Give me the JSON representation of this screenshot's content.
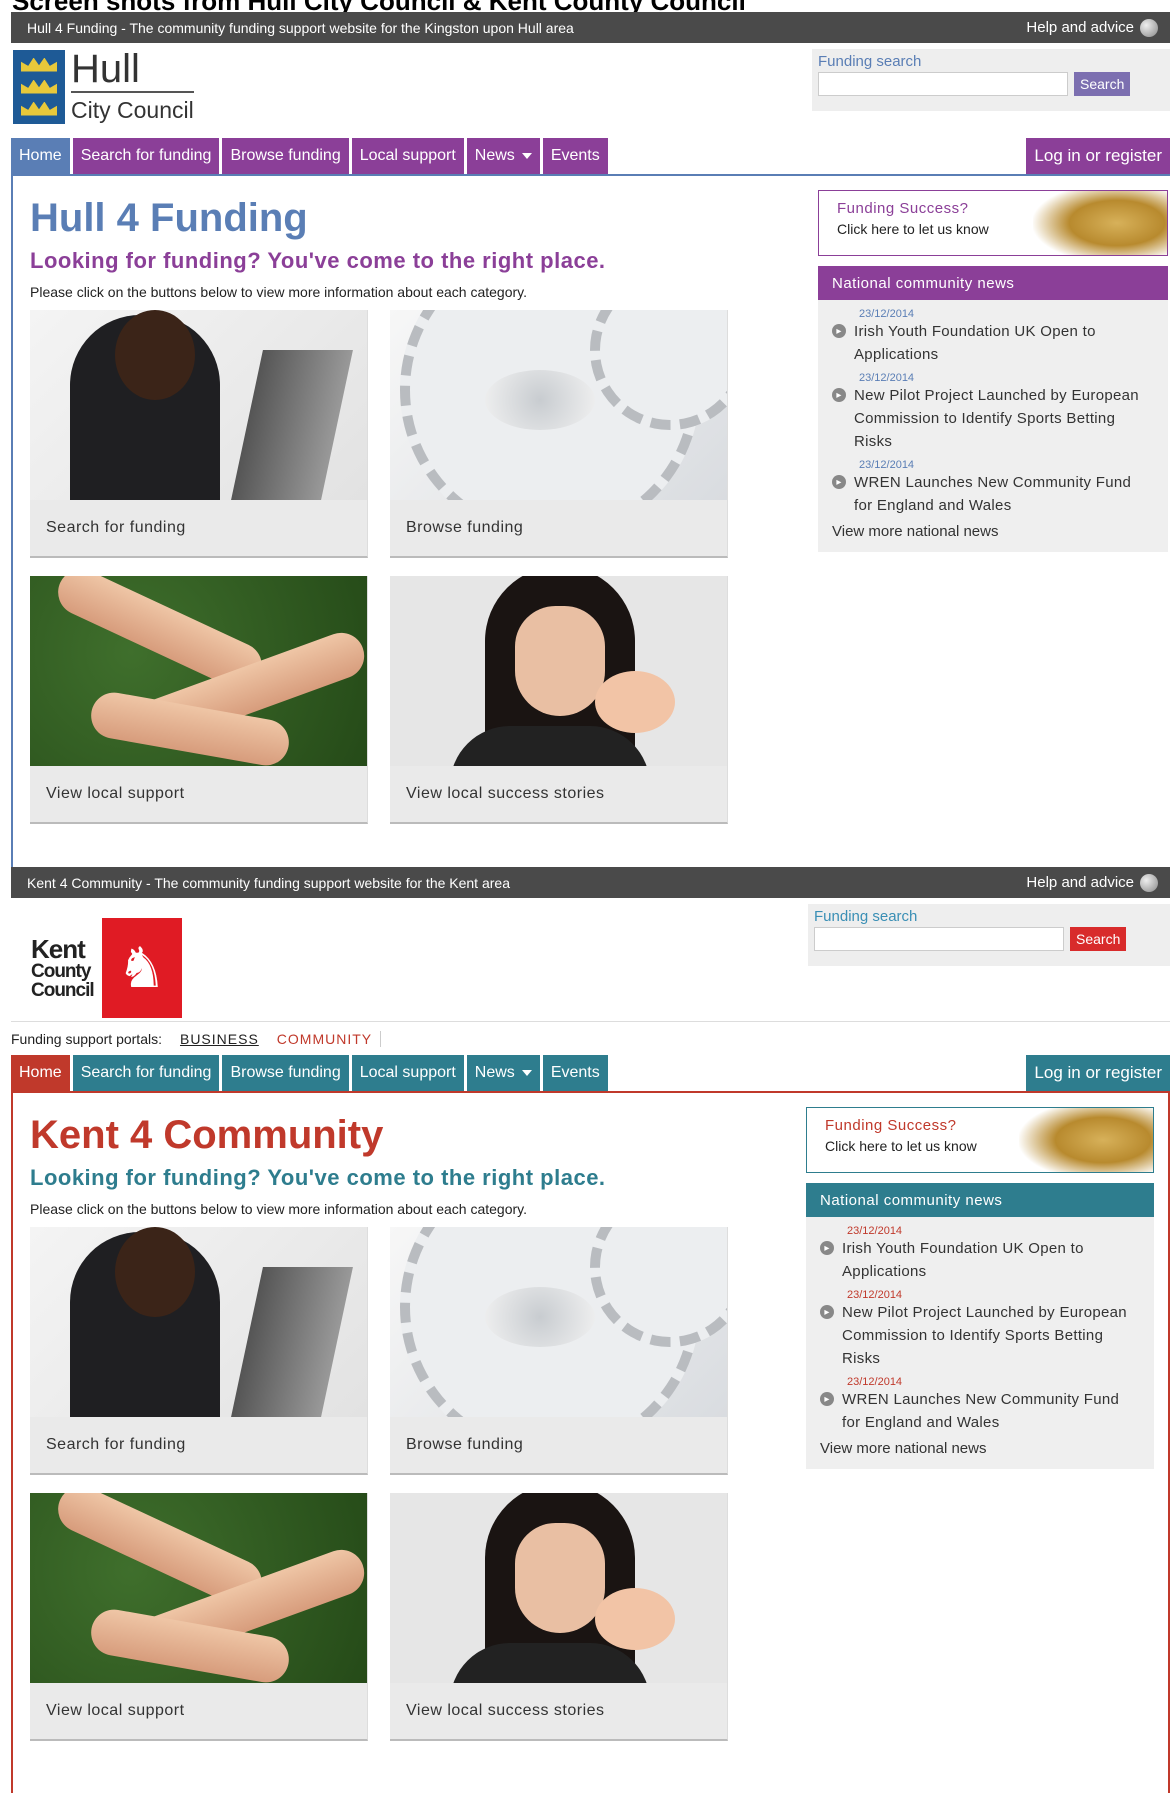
{
  "caption": "Screen shots from Hull City Council & Kent County Council",
  "colors": {
    "hull_primary": "#5a7eb5",
    "hull_accent": "#8b3f98",
    "kent_primary": "#c0392b",
    "kent_accent": "#2e7d8e"
  },
  "hull": {
    "topbar": {
      "title": "Hull 4 Funding - The community funding support website for the Kingston upon Hull area",
      "help": "Help and advice"
    },
    "logo": {
      "line1": "Hull",
      "line2": "City Council"
    },
    "search": {
      "label": "Funding search",
      "button": "Search",
      "value": ""
    },
    "nav": {
      "home": "Home",
      "search": "Search for funding",
      "browse": "Browse funding",
      "local": "Local support",
      "news": "News",
      "events": "Events",
      "login": "Log in or register"
    },
    "main": {
      "title": "Hull 4 Funding",
      "subtitle": "Looking for funding? You've come to the right place.",
      "intro": "Please click on the buttons below to view more information about each category.",
      "tiles": [
        "Search for funding",
        "Browse funding",
        "View local support",
        "View local success stories"
      ]
    },
    "success": {
      "line1": "Funding Success?",
      "line2": "Click here to let us know"
    },
    "news": {
      "heading": "National community news",
      "items": [
        {
          "date": "23/12/2014",
          "title": "Irish Youth Foundation UK Open to Applications"
        },
        {
          "date": "23/12/2014",
          "title": "New Pilot Project Launched by European Commission to Identify Sports Betting Risks"
        },
        {
          "date": "23/12/2014",
          "title": "WREN Launches New Community Fund for England and Wales"
        }
      ],
      "more": "View more national news"
    }
  },
  "kent": {
    "topbar": {
      "title": "Kent 4 Community - The community funding support website for the Kent area",
      "help": "Help and advice"
    },
    "logo": {
      "line1": "Kent",
      "line2": "County",
      "line3": "Council"
    },
    "search": {
      "label": "Funding search",
      "button": "Search",
      "value": ""
    },
    "portals": {
      "label": "Funding support portals:",
      "business": "BUSINESS",
      "community": "COMMUNITY"
    },
    "nav": {
      "home": "Home",
      "search": "Search for funding",
      "browse": "Browse funding",
      "local": "Local support",
      "news": "News",
      "events": "Events",
      "login": "Log in or register"
    },
    "main": {
      "title": "Kent 4 Community",
      "subtitle": "Looking for funding? You've come to the right place.",
      "intro": "Please click on the buttons below to view more information about each category.",
      "tiles": [
        "Search for funding",
        "Browse funding",
        "View local support",
        "View local success stories"
      ]
    },
    "success": {
      "line1": "Funding Success?",
      "line2": "Click here to let us know"
    },
    "news": {
      "heading": "National community news",
      "items": [
        {
          "date": "23/12/2014",
          "title": "Irish Youth Foundation UK Open to Applications"
        },
        {
          "date": "23/12/2014",
          "title": "New Pilot Project Launched by European Commission to Identify Sports Betting Risks"
        },
        {
          "date": "23/12/2014",
          "title": "WREN Launches New Community Fund for England and Wales"
        }
      ],
      "more": "View more national news"
    }
  }
}
